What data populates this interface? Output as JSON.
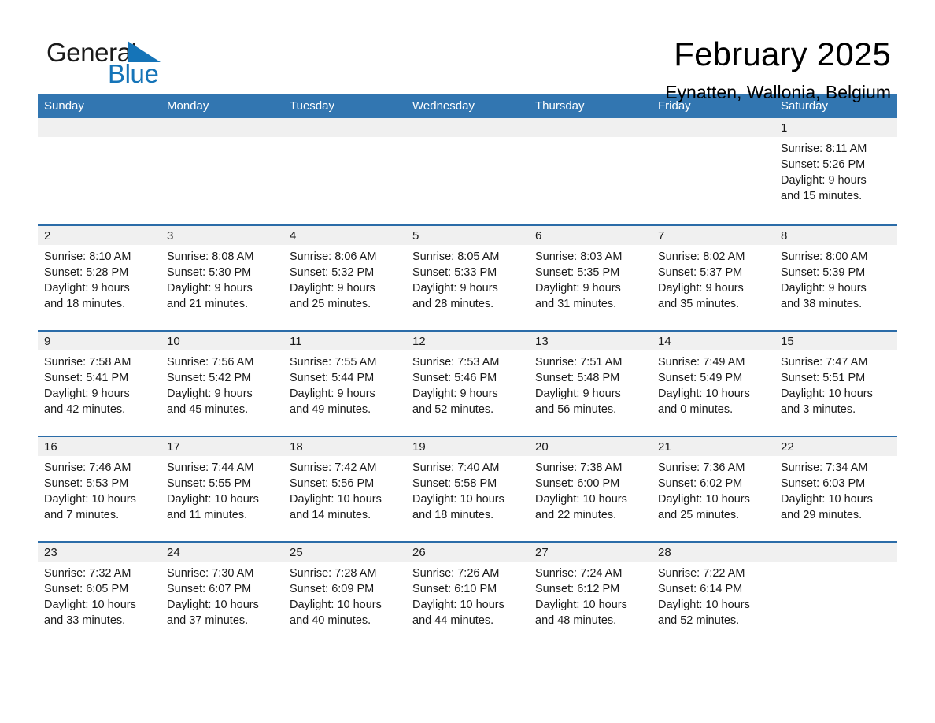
{
  "brand": {
    "name_part1": "General",
    "name_part2": "Blue",
    "accent_color": "#1574b8"
  },
  "header": {
    "title": "February 2025",
    "subtitle": "Eynatten, Wallonia, Belgium"
  },
  "calendar": {
    "header_bg": "#3276b1",
    "row_divider_color": "#2b6ca8",
    "daynum_band_bg": "#f0f0f0",
    "weekday_headers": [
      "Sunday",
      "Monday",
      "Tuesday",
      "Wednesday",
      "Thursday",
      "Friday",
      "Saturday"
    ],
    "weeks": [
      [
        {
          "day": "",
          "lines": []
        },
        {
          "day": "",
          "lines": []
        },
        {
          "day": "",
          "lines": []
        },
        {
          "day": "",
          "lines": []
        },
        {
          "day": "",
          "lines": []
        },
        {
          "day": "",
          "lines": []
        },
        {
          "day": "1",
          "lines": [
            "Sunrise: 8:11 AM",
            "Sunset: 5:26 PM",
            "Daylight: 9 hours",
            "and 15 minutes."
          ]
        }
      ],
      [
        {
          "day": "2",
          "lines": [
            "Sunrise: 8:10 AM",
            "Sunset: 5:28 PM",
            "Daylight: 9 hours",
            "and 18 minutes."
          ]
        },
        {
          "day": "3",
          "lines": [
            "Sunrise: 8:08 AM",
            "Sunset: 5:30 PM",
            "Daylight: 9 hours",
            "and 21 minutes."
          ]
        },
        {
          "day": "4",
          "lines": [
            "Sunrise: 8:06 AM",
            "Sunset: 5:32 PM",
            "Daylight: 9 hours",
            "and 25 minutes."
          ]
        },
        {
          "day": "5",
          "lines": [
            "Sunrise: 8:05 AM",
            "Sunset: 5:33 PM",
            "Daylight: 9 hours",
            "and 28 minutes."
          ]
        },
        {
          "day": "6",
          "lines": [
            "Sunrise: 8:03 AM",
            "Sunset: 5:35 PM",
            "Daylight: 9 hours",
            "and 31 minutes."
          ]
        },
        {
          "day": "7",
          "lines": [
            "Sunrise: 8:02 AM",
            "Sunset: 5:37 PM",
            "Daylight: 9 hours",
            "and 35 minutes."
          ]
        },
        {
          "day": "8",
          "lines": [
            "Sunrise: 8:00 AM",
            "Sunset: 5:39 PM",
            "Daylight: 9 hours",
            "and 38 minutes."
          ]
        }
      ],
      [
        {
          "day": "9",
          "lines": [
            "Sunrise: 7:58 AM",
            "Sunset: 5:41 PM",
            "Daylight: 9 hours",
            "and 42 minutes."
          ]
        },
        {
          "day": "10",
          "lines": [
            "Sunrise: 7:56 AM",
            "Sunset: 5:42 PM",
            "Daylight: 9 hours",
            "and 45 minutes."
          ]
        },
        {
          "day": "11",
          "lines": [
            "Sunrise: 7:55 AM",
            "Sunset: 5:44 PM",
            "Daylight: 9 hours",
            "and 49 minutes."
          ]
        },
        {
          "day": "12",
          "lines": [
            "Sunrise: 7:53 AM",
            "Sunset: 5:46 PM",
            "Daylight: 9 hours",
            "and 52 minutes."
          ]
        },
        {
          "day": "13",
          "lines": [
            "Sunrise: 7:51 AM",
            "Sunset: 5:48 PM",
            "Daylight: 9 hours",
            "and 56 minutes."
          ]
        },
        {
          "day": "14",
          "lines": [
            "Sunrise: 7:49 AM",
            "Sunset: 5:49 PM",
            "Daylight: 10 hours",
            "and 0 minutes."
          ]
        },
        {
          "day": "15",
          "lines": [
            "Sunrise: 7:47 AM",
            "Sunset: 5:51 PM",
            "Daylight: 10 hours",
            "and 3 minutes."
          ]
        }
      ],
      [
        {
          "day": "16",
          "lines": [
            "Sunrise: 7:46 AM",
            "Sunset: 5:53 PM",
            "Daylight: 10 hours",
            "and 7 minutes."
          ]
        },
        {
          "day": "17",
          "lines": [
            "Sunrise: 7:44 AM",
            "Sunset: 5:55 PM",
            "Daylight: 10 hours",
            "and 11 minutes."
          ]
        },
        {
          "day": "18",
          "lines": [
            "Sunrise: 7:42 AM",
            "Sunset: 5:56 PM",
            "Daylight: 10 hours",
            "and 14 minutes."
          ]
        },
        {
          "day": "19",
          "lines": [
            "Sunrise: 7:40 AM",
            "Sunset: 5:58 PM",
            "Daylight: 10 hours",
            "and 18 minutes."
          ]
        },
        {
          "day": "20",
          "lines": [
            "Sunrise: 7:38 AM",
            "Sunset: 6:00 PM",
            "Daylight: 10 hours",
            "and 22 minutes."
          ]
        },
        {
          "day": "21",
          "lines": [
            "Sunrise: 7:36 AM",
            "Sunset: 6:02 PM",
            "Daylight: 10 hours",
            "and 25 minutes."
          ]
        },
        {
          "day": "22",
          "lines": [
            "Sunrise: 7:34 AM",
            "Sunset: 6:03 PM",
            "Daylight: 10 hours",
            "and 29 minutes."
          ]
        }
      ],
      [
        {
          "day": "23",
          "lines": [
            "Sunrise: 7:32 AM",
            "Sunset: 6:05 PM",
            "Daylight: 10 hours",
            "and 33 minutes."
          ]
        },
        {
          "day": "24",
          "lines": [
            "Sunrise: 7:30 AM",
            "Sunset: 6:07 PM",
            "Daylight: 10 hours",
            "and 37 minutes."
          ]
        },
        {
          "day": "25",
          "lines": [
            "Sunrise: 7:28 AM",
            "Sunset: 6:09 PM",
            "Daylight: 10 hours",
            "and 40 minutes."
          ]
        },
        {
          "day": "26",
          "lines": [
            "Sunrise: 7:26 AM",
            "Sunset: 6:10 PM",
            "Daylight: 10 hours",
            "and 44 minutes."
          ]
        },
        {
          "day": "27",
          "lines": [
            "Sunrise: 7:24 AM",
            "Sunset: 6:12 PM",
            "Daylight: 10 hours",
            "and 48 minutes."
          ]
        },
        {
          "day": "28",
          "lines": [
            "Sunrise: 7:22 AM",
            "Sunset: 6:14 PM",
            "Daylight: 10 hours",
            "and 52 minutes."
          ]
        },
        {
          "day": "",
          "lines": []
        }
      ]
    ]
  }
}
